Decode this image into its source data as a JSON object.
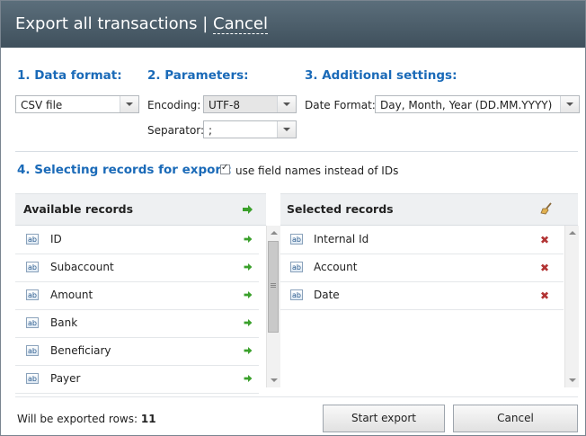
{
  "title": {
    "text": "Export all transactions",
    "separator": "|",
    "cancel_link": "Cancel"
  },
  "sections": {
    "data_format": {
      "heading": "1. Data format:",
      "value": "CSV file"
    },
    "parameters": {
      "heading": "2. Parameters:",
      "encoding_label": "Encoding:",
      "encoding_value": "UTF-8",
      "separator_label": "Separator:",
      "separator_value": ";"
    },
    "additional": {
      "heading": "3. Additional settings:",
      "date_format_label": "Date Format:",
      "date_format_value": "Day, Month, Year (DD.MM.YYYY)"
    },
    "selecting": {
      "heading": "4. Selecting records for export:",
      "checkbox_label": "use field names instead of IDs",
      "checkbox_checked": true
    }
  },
  "available": {
    "header": "Available records",
    "items": [
      "ID",
      "Subaccount",
      "Amount",
      "Bank",
      "Beneficiary",
      "Payer"
    ]
  },
  "selected": {
    "header": "Selected records",
    "items": [
      "Internal Id",
      "Account",
      "Date"
    ]
  },
  "footer": {
    "rows_label": "Will be exported rows:",
    "rows_count": "11",
    "start_button": "Start export",
    "cancel_button": "Cancel"
  },
  "icons": {
    "field_type": "ab",
    "add_arrow_color": "#3aa02b",
    "remove_color": "#b23333",
    "accent_color": "#1a6ab8",
    "titlebar_color": "#4a5b67"
  }
}
